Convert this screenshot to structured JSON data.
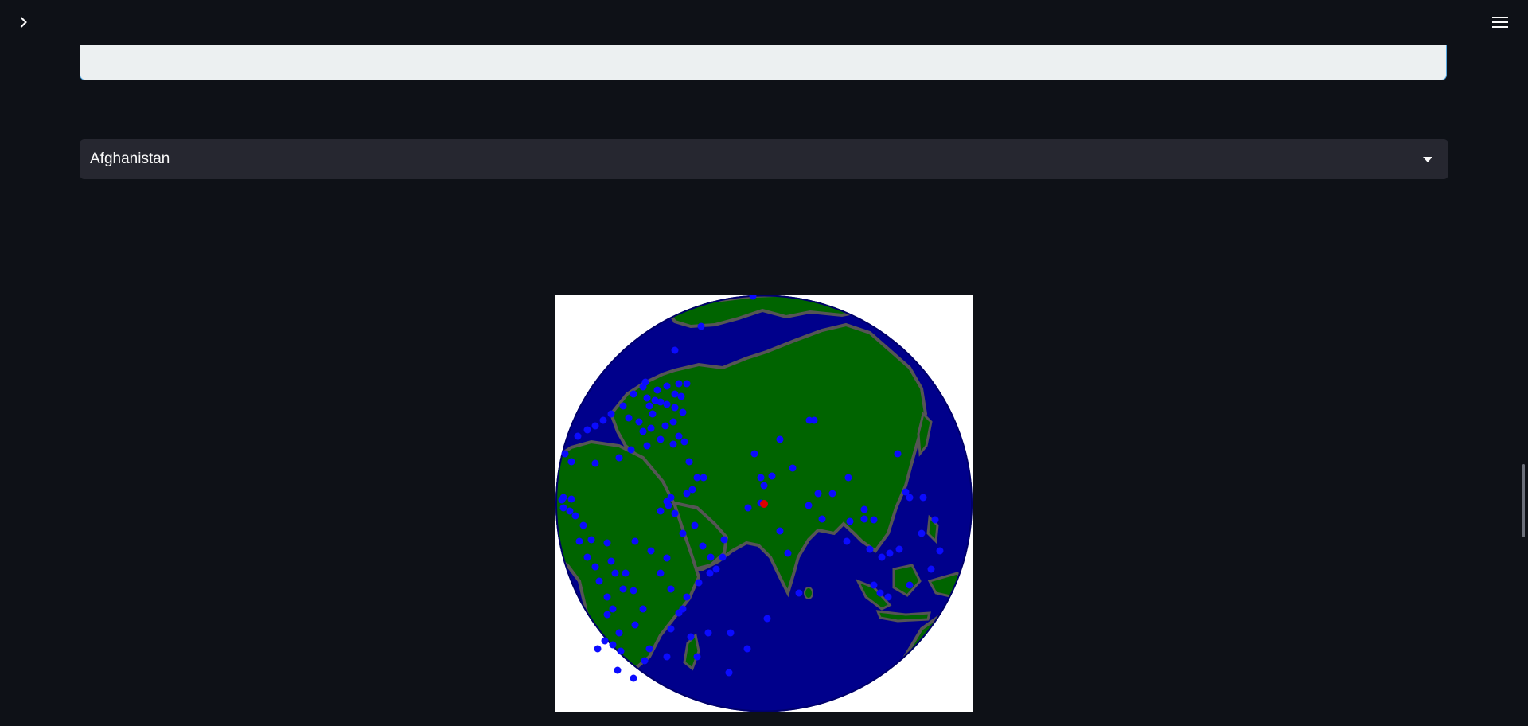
{
  "header": {
    "sidebar_toggle_icon": "chevron-right-icon",
    "menu_icon": "hamburger-menu-icon"
  },
  "text_area": {
    "value": ""
  },
  "country_select": {
    "selected": "Afghanistan",
    "arrow_icon": "caret-down-icon"
  },
  "globe_map": {
    "selected_marker_color": "#e00000",
    "marker_color": "#0b0bff",
    "ocean_color": "#00008b",
    "land_color": "#006400",
    "coast_color": "#555555"
  }
}
